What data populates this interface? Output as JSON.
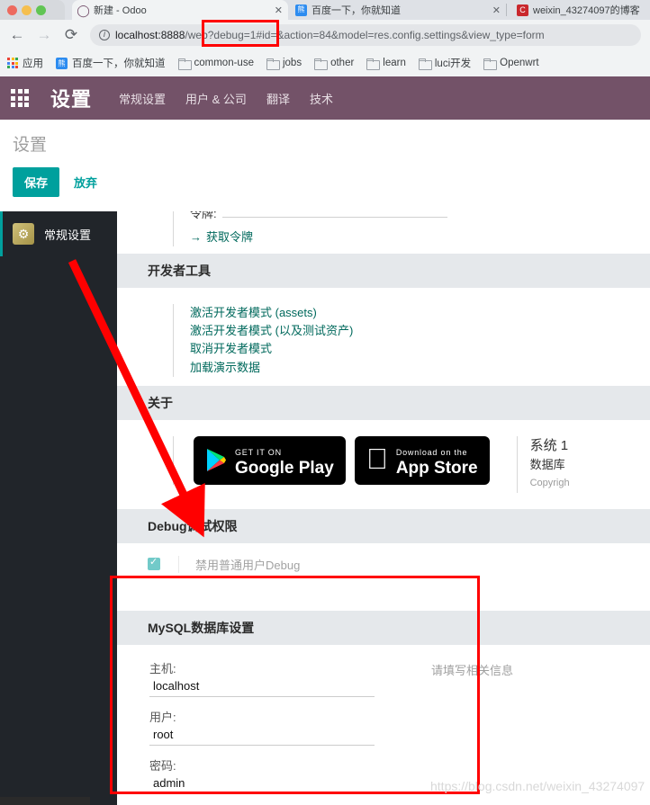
{
  "browser": {
    "tabs": [
      {
        "title": "新建 - Odoo",
        "favicon": "odoo-icon",
        "active": true,
        "close_label": "✕"
      },
      {
        "title": "百度一下，你就知道",
        "favicon": "baidu-icon",
        "active": false,
        "close_label": "✕"
      },
      {
        "title": "weixin_43274097的博客",
        "favicon": "csdn-icon",
        "active": false,
        "close_label": ""
      }
    ],
    "nav": {
      "back": "←",
      "forward": "→",
      "reload": "⟳"
    },
    "omnibox": {
      "info_icon": "i",
      "url_host": "localhost:8888",
      "url_rest": "/web?debug=1#id=&action=84&model=res.config.settings&view_type=form"
    },
    "bookmarks": [
      {
        "label": "应用",
        "icon": "apps-grid-icon"
      },
      {
        "label": "百度一下，你就知道",
        "icon": "baidu-icon"
      },
      {
        "label": "common-use",
        "icon": "folder-icon"
      },
      {
        "label": "jobs",
        "icon": "folder-icon"
      },
      {
        "label": "other",
        "icon": "folder-icon"
      },
      {
        "label": "learn",
        "icon": "folder-icon"
      },
      {
        "label": "luci开发",
        "icon": "folder-icon"
      },
      {
        "label": "Openwrt",
        "icon": "folder-icon"
      }
    ]
  },
  "odoo": {
    "header": {
      "apps_icon": "apps-grid-icon",
      "app_name": "设置",
      "menus": [
        "常规设置",
        "用户 & 公司",
        "翻译",
        "技术"
      ]
    },
    "breadcrumb": "设置",
    "actions": {
      "save": "保存",
      "discard": "放弃"
    },
    "sidebar": {
      "items": [
        {
          "label": "常规设置",
          "icon": "gear-icon"
        }
      ]
    },
    "sections": {
      "token": {
        "label": "令牌:",
        "link": "获取令牌"
      },
      "developer_tools": {
        "title": "开发者工具",
        "links": [
          "激活开发者模式 (assets)",
          "激活开发者模式 (以及测试资产)",
          "取消开发者模式",
          "加载演示数据"
        ]
      },
      "about": {
        "title": "关于",
        "google_play": {
          "small": "GET IT ON",
          "large": "Google Play"
        },
        "app_store": {
          "small": "Download on the",
          "large": "App Store"
        },
        "version_line": "系统 1",
        "database_line": "数据库",
        "copyright_line": "Copyrigh"
      },
      "debug": {
        "title": "Debug调试权限",
        "checkbox_label": "禁用普通用户Debug",
        "checked": true
      },
      "mysql": {
        "title": "MySQL数据库设置",
        "hint": "请填写相关信息",
        "fields": [
          {
            "label": "主机:",
            "value": "localhost"
          },
          {
            "label": "用户:",
            "value": "root"
          },
          {
            "label": "密码:",
            "value": "admin"
          }
        ]
      }
    }
  },
  "annotations": {
    "colors": {
      "highlight": "#ff0000",
      "accent": "#00a09d",
      "brand": "#735268"
    },
    "watermark": "https://blog.csdn.net/weixin_43274097"
  }
}
